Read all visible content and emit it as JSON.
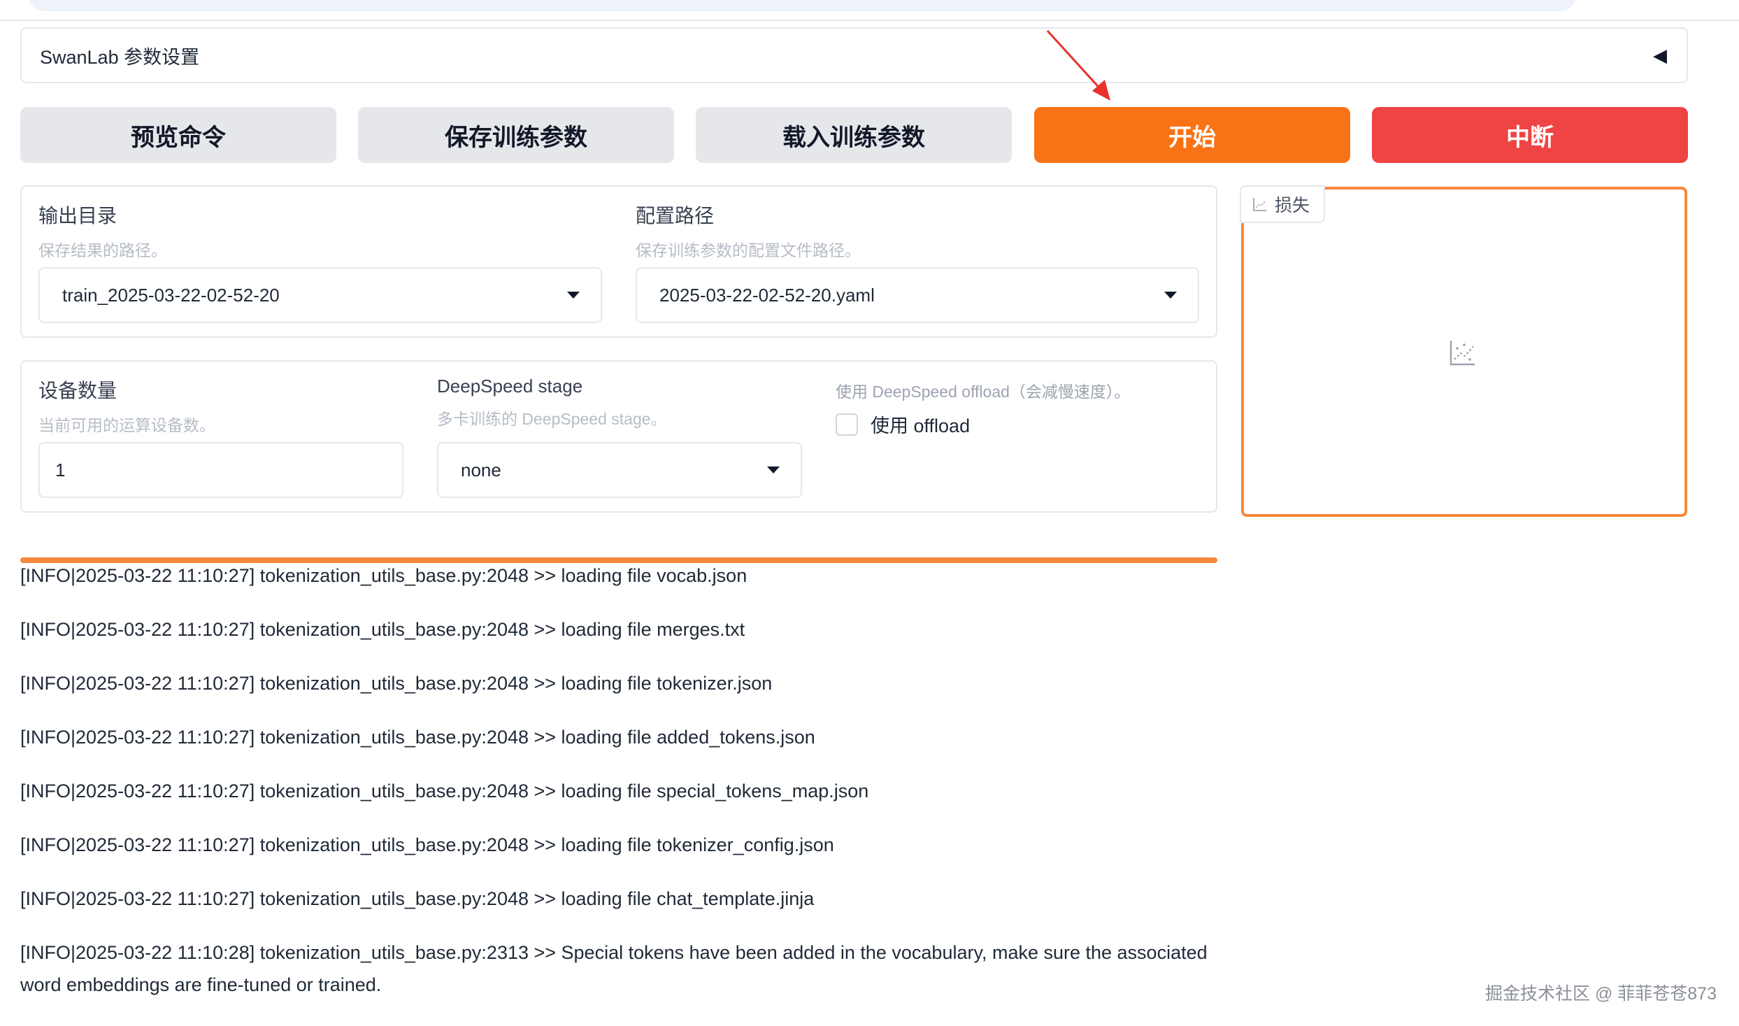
{
  "accordion": {
    "title": "SwanLab 参数设置",
    "toggle_glyph": "◀"
  },
  "actions": {
    "preview_label": "预览命令",
    "save_label": "保存训练参数",
    "load_label": "载入训练参数",
    "start_label": "开始",
    "abort_label": "中断",
    "colors": {
      "start": "#f97316",
      "abort": "#ef4444",
      "neutral": "#e5e7eb"
    }
  },
  "paths": {
    "output_dir": {
      "label": "输出目录",
      "info": "保存结果的路径。",
      "value": "train_2025-03-22-02-52-20"
    },
    "config_path": {
      "label": "配置路径",
      "info": "保存训练参数的配置文件路径。",
      "value": "2025-03-22-02-52-20.yaml"
    }
  },
  "devices": {
    "device_count": {
      "label": "设备数量",
      "info": "当前可用的运算设备数。",
      "value": "1"
    },
    "ds_stage": {
      "label": "DeepSpeed stage",
      "info": "多卡训练的 DeepSpeed stage。",
      "value": "none"
    },
    "ds_offload": {
      "label": "使用 DeepSpeed offload（会减慢速度）。",
      "checkbox_label": "使用 offload",
      "checked": false
    }
  },
  "loss_chart": {
    "tab_label": "损失",
    "tab_icon": "chart-icon",
    "empty_icon": "chart-placeholder-icon",
    "accent": "#f5883b"
  },
  "log": {
    "progress_color": "#f5883b",
    "lines": [
      "[INFO|2025-03-22 11:10:27] tokenization_utils_base.py:2048 >> loading file vocab.json",
      "[INFO|2025-03-22 11:10:27] tokenization_utils_base.py:2048 >> loading file merges.txt",
      "[INFO|2025-03-22 11:10:27] tokenization_utils_base.py:2048 >> loading file tokenizer.json",
      "[INFO|2025-03-22 11:10:27] tokenization_utils_base.py:2048 >> loading file added_tokens.json",
      "[INFO|2025-03-22 11:10:27] tokenization_utils_base.py:2048 >> loading file special_tokens_map.json",
      "[INFO|2025-03-22 11:10:27] tokenization_utils_base.py:2048 >> loading file tokenizer_config.json",
      "[INFO|2025-03-22 11:10:27] tokenization_utils_base.py:2048 >> loading file chat_template.jinja",
      "[INFO|2025-03-22 11:10:28] tokenization_utils_base.py:2313 >> Special tokens have been added in the vocabulary, make sure the associated word embeddings are fine-tuned or trained."
    ]
  },
  "watermark": "掘金技术社区 @ 菲菲苍苍873",
  "annotation": {
    "color": "#e8322b"
  }
}
